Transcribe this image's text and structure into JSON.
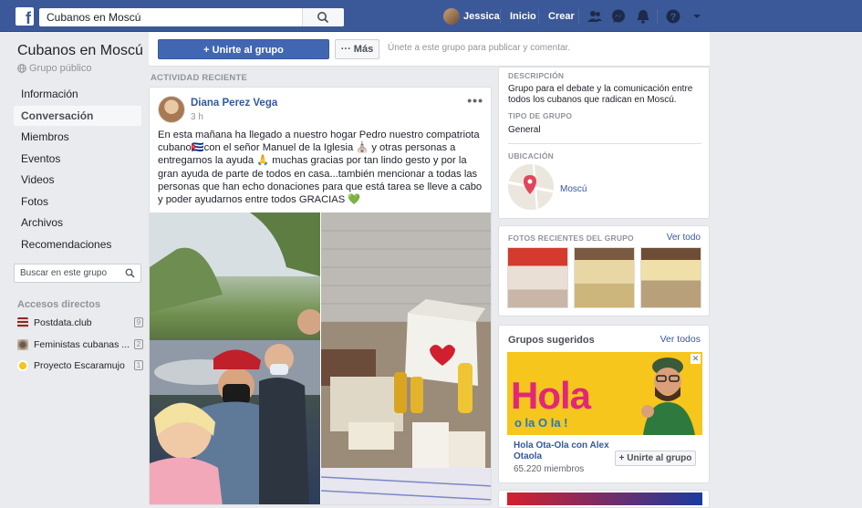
{
  "topbar": {
    "logo": "f",
    "search_value": "Cubanos en Moscú",
    "user_name": "Jessica",
    "home_label": "Inicio",
    "create_label": "Crear",
    "icons": [
      "friends-icon",
      "messenger-icon",
      "notifications-icon",
      "help-icon",
      "dropdown-icon"
    ]
  },
  "group": {
    "name": "Cubanos en Moscú",
    "privacy": "Grupo público"
  },
  "nav": [
    "Información",
    "Conversación",
    "Miembros",
    "Eventos",
    "Videos",
    "Fotos",
    "Archivos",
    "Recomendaciones"
  ],
  "nav_active": "Conversación",
  "group_search_placeholder": "Buscar en este grupo",
  "shortcuts": {
    "title": "Accesos directos",
    "items": [
      {
        "label": "Postdata.club",
        "count": "9"
      },
      {
        "label": "Feministas cubanas ...",
        "count": "2"
      },
      {
        "label": "Proyecto Escaramujo",
        "count": "1"
      }
    ]
  },
  "joinbar": {
    "join_label": "+ Unirte al grupo",
    "more_label": "··· Más",
    "hint": "Únete a este grupo para publicar y comentar."
  },
  "activity_label": "ACTIVIDAD RECIENTE",
  "post": {
    "author": "Diana Perez Vega",
    "time": "3 h",
    "text": "En esta mañana ha llegado a nuestro hogar Pedro nuestro compatriota cubano🇨🇺con el señor Manuel de la Iglesia ⛪ y otras personas a entregarnos la ayuda 🙏 muchas gracias por tan lindo gesto y por la gran ayuda de parte de todos en casa...también mencionar a todas las personas que han echo donaciones para que está tarea se lleve a cabo y poder ayudarnos entre todos GRACIAS 💚"
  },
  "about": {
    "desc_title": "DESCRIPCIÓN",
    "desc_text": "Grupo para el debate y la comunicación entre todos los cubanos que radican en Moscú.",
    "type_title": "TIPO DE GRUPO",
    "type_value": "General",
    "loc_title": "UBICACIÓN",
    "loc_value": "Moscú"
  },
  "photos": {
    "title": "FOTOS RECIENTES DEL GRUPO",
    "see_all": "Ver todo"
  },
  "suggested": {
    "title": "Grupos sugeridos",
    "see_all": "Ver todos",
    "banner_text": "Hola",
    "banner_sub": "o la O la !",
    "group_name": "Hola Ota-Ola con Alex Otaola",
    "members": "65.220 miembros",
    "join_label": "+ Unirte al grupo"
  }
}
